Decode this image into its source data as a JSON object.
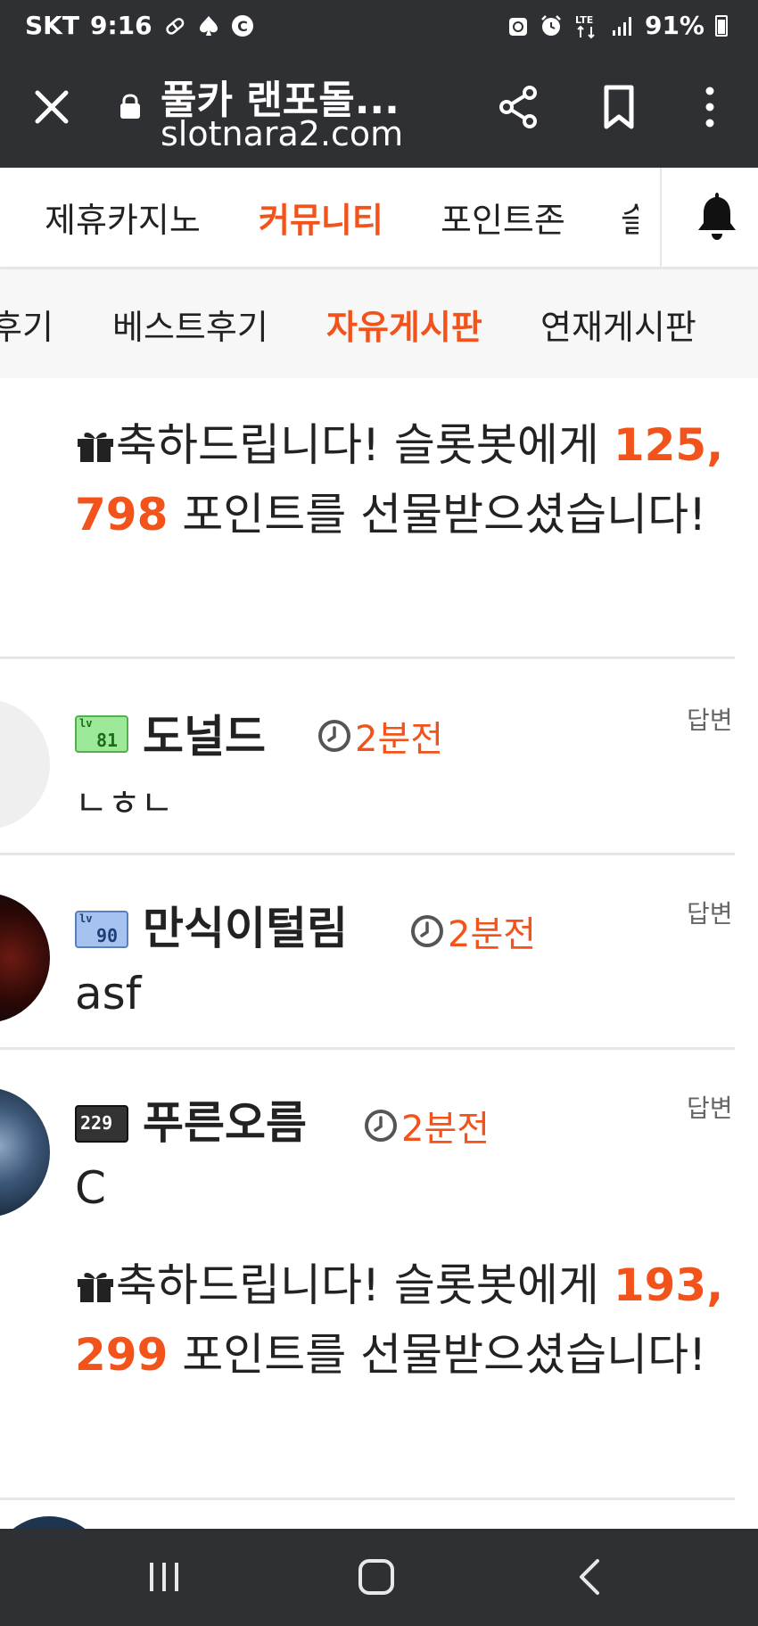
{
  "status_bar": {
    "carrier": "SKT",
    "time": "9:16",
    "battery": "91%",
    "icons": [
      "pill-icon",
      "spade-icon",
      "c-circle-icon",
      "recycle-icon",
      "alarm-icon",
      "lte-icon",
      "signal-icon",
      "battery-icon"
    ]
  },
  "browser": {
    "title": "풀카 랜포돌...",
    "domain": "slotnara2.com",
    "icons": [
      "close-icon",
      "lock-icon",
      "share-icon",
      "bookmark-icon",
      "more-icon"
    ]
  },
  "main_nav": {
    "items": [
      {
        "label": "제휴카지노",
        "active": false
      },
      {
        "label": "커뮤니티",
        "active": true
      },
      {
        "label": "포인트존",
        "active": false
      },
      {
        "label": "슬",
        "active": false
      }
    ]
  },
  "sub_nav": {
    "items": [
      {
        "label": "후기",
        "active": false
      },
      {
        "label": "베스트후기",
        "active": false
      },
      {
        "label": "자유게시판",
        "active": true
      },
      {
        "label": "연재게시판",
        "active": false
      }
    ]
  },
  "gift_messages": [
    {
      "prefix": "축하드립니다! 슬롯봇에게 ",
      "points": "125,798",
      "suffix": " 포인트를 선물받으셨습니다!"
    },
    {
      "prefix": "축하드립니다! 슬롯봇에게 ",
      "points": "193,299",
      "suffix": " 포인트를 선물받으셨습니다!"
    }
  ],
  "comments": [
    {
      "nickname": "도널드",
      "level": "81",
      "time": "2분전",
      "reply_label": "답변",
      "text": "ㄴㅎㄴ"
    },
    {
      "nickname": "만식이털림",
      "level": "90",
      "time": "2분전",
      "reply_label": "답변",
      "text": "asf"
    },
    {
      "nickname": "푸른오름",
      "level": "229",
      "time": "2분전",
      "reply_label": "답변",
      "text": "C"
    }
  ],
  "bottom_nav": {
    "icons": [
      "recent-apps-icon",
      "home-icon",
      "back-icon"
    ]
  },
  "colors": {
    "accent": "#f2531b",
    "bar_bg": "#2f3033",
    "divider": "#e6e6e6"
  }
}
